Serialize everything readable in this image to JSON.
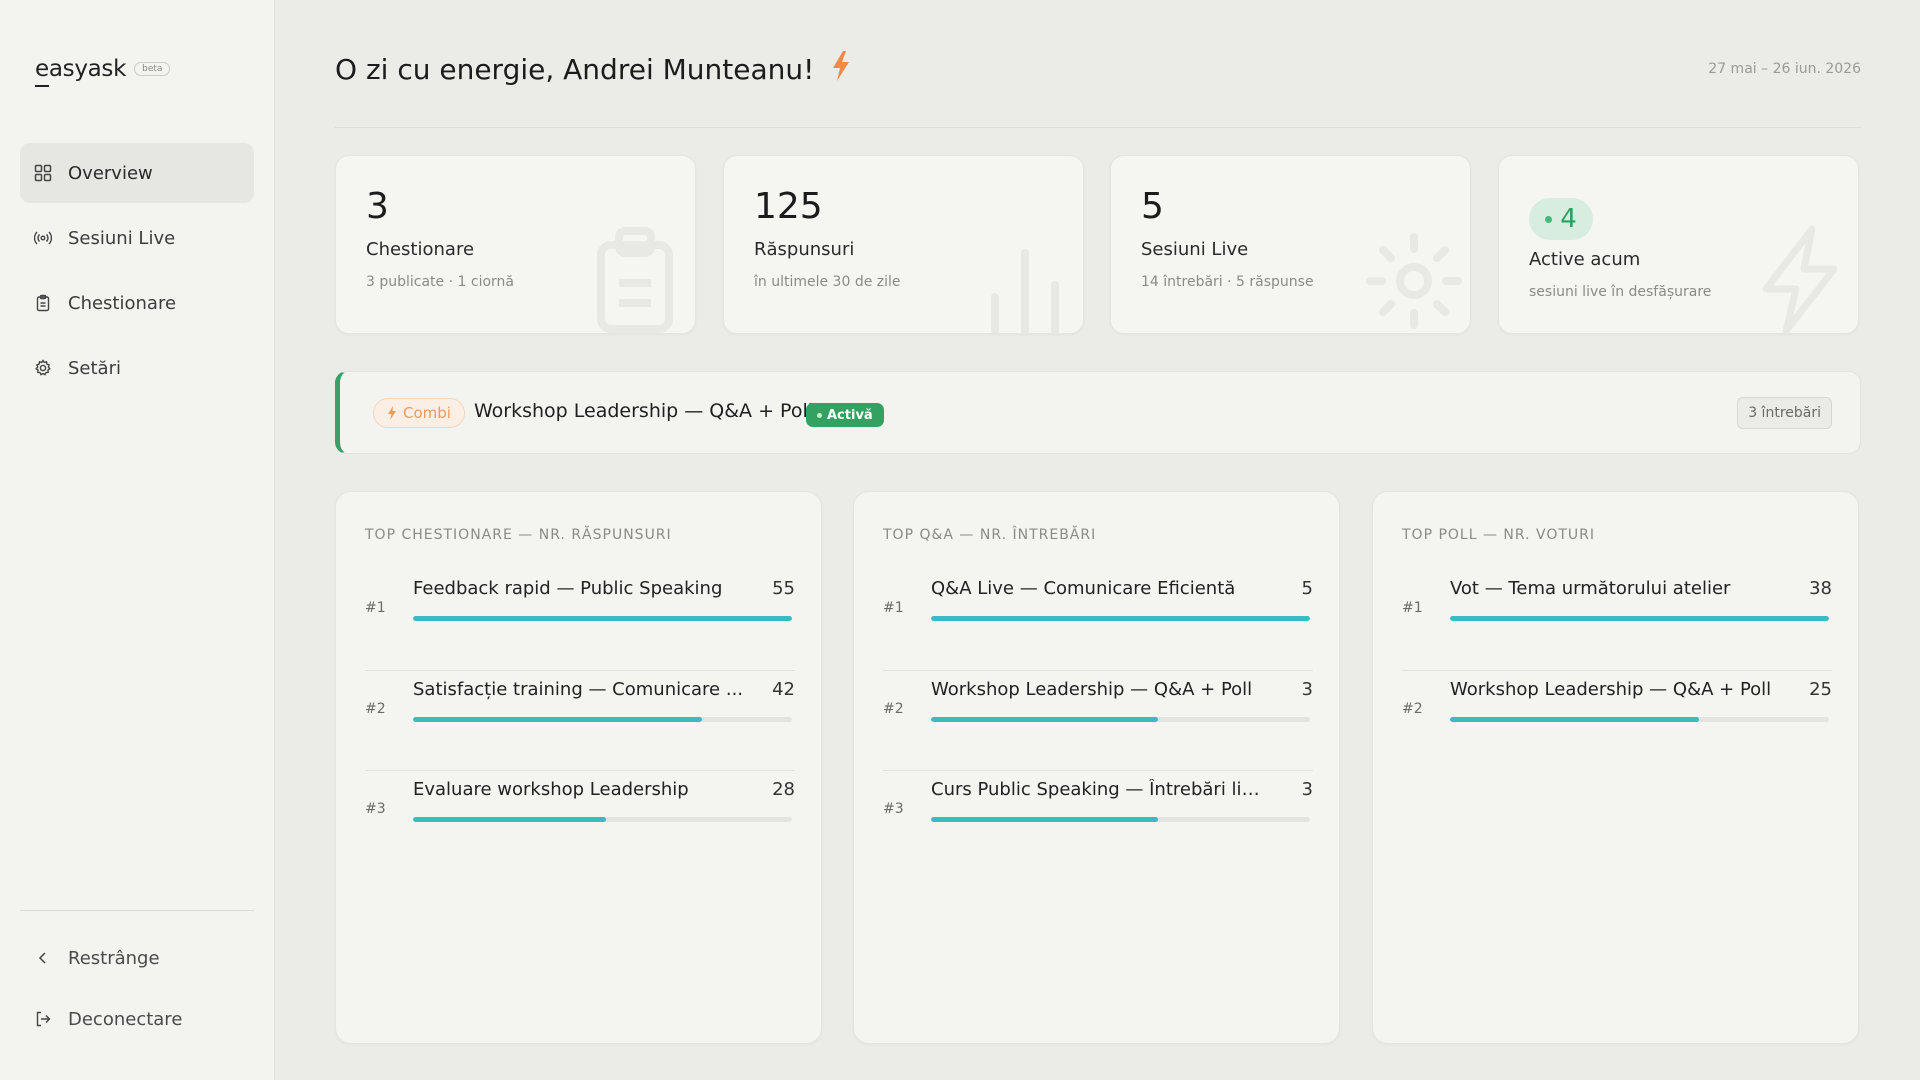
{
  "app": {
    "logo": "easyask",
    "beta": "beta"
  },
  "sidebar": {
    "items": [
      {
        "label": "Overview",
        "icon": "grid-icon",
        "active": true
      },
      {
        "label": "Sesiuni Live",
        "icon": "broadcast-icon"
      },
      {
        "label": "Chestionare",
        "icon": "clipboard-icon"
      },
      {
        "label": "Setări",
        "icon": "gear-icon"
      }
    ],
    "collapse_label": "Restrânge",
    "logout_label": "Deconectare"
  },
  "header": {
    "greeting": "O zi cu energie, Andrei Munteanu!",
    "date_range": "27 mai – 26 iun. 2026"
  },
  "stats": [
    {
      "value": "3",
      "label": "Chestionare",
      "sub": "3 publicate · 1 ciornă",
      "icon": "clipboard-icon"
    },
    {
      "value": "125",
      "label": "Răspunsuri",
      "sub": "în ultimele 30 de zile",
      "icon": "bar-chart-icon"
    },
    {
      "value": "5",
      "label": "Sesiuni Live",
      "sub": "14 întrebări · 5 răspunse",
      "icon": "sun-icon"
    },
    {
      "value": "4",
      "label": "Active acum",
      "sub": "sesiuni live în desfășurare",
      "icon": "lightning-icon"
    }
  ],
  "session": {
    "type_badge": "Combi",
    "title": "Workshop Leadership — Q&A + Poll",
    "status": "Activă",
    "questions": "3 întrebări",
    "colors": {
      "accent": "#3aa065",
      "badge": "#f09a58"
    }
  },
  "panels": [
    {
      "title": "TOP CHESTIONARE — NR. RĂSPUNSURI",
      "max": 55,
      "items": [
        {
          "rank": "#1",
          "label": "Feedback rapid — Public Speaking",
          "value": 55
        },
        {
          "rank": "#2",
          "label": "Satisfacție training — Comunicare ...",
          "value": 42
        },
        {
          "rank": "#3",
          "label": "Evaluare workshop Leadership",
          "value": 28
        }
      ]
    },
    {
      "title": "TOP Q&A — NR. ÎNTREBĂRI",
      "max": 5,
      "items": [
        {
          "rank": "#1",
          "label": "Q&A Live — Comunicare Eficientă",
          "value": 5
        },
        {
          "rank": "#2",
          "label": "Workshop Leadership — Q&A + Poll",
          "value": 3
        },
        {
          "rank": "#3",
          "label": "Curs Public Speaking — Întrebări live",
          "value": 3
        }
      ]
    },
    {
      "title": "TOP POLL — NR. VOTURI",
      "max": 38,
      "items": [
        {
          "rank": "#1",
          "label": "Vot — Tema următorului atelier",
          "value": 38
        },
        {
          "rank": "#2",
          "label": "Workshop Leadership — Q&A + Poll",
          "value": 25
        }
      ]
    }
  ],
  "colors": {
    "bar": "#37bcc4",
    "active_green": "#33a15f"
  }
}
